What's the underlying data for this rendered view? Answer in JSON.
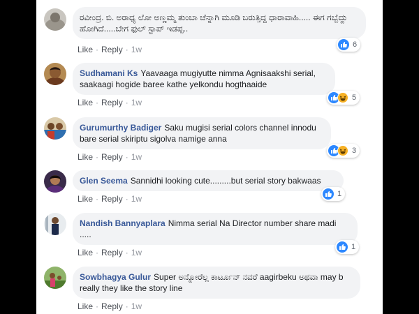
{
  "actions": {
    "like": "Like",
    "reply": "Reply",
    "separator": "·"
  },
  "comments": [
    {
      "name": "",
      "text": "ರವೀಂದ್ರ. ಬಿ. ಅರಾಧ್ಯ ಲೋ ಅಣ್ಣಮ್ಮ ತುಂಬಾ ಚೆನ್ನಾಗಿ ಮೂಡಿ ಬರುತ್ತಿದ್ದ ಧಾರಾವಾಹಿ..... ಈಗ ಗಬ್ಬೆದ್ದು ಹೋಗಿದೆ.....ಬೇಗ ಫುಲ್ ಸ್ಟಾಪ್ ಇಡಪ್ಪ..",
      "time": "1w",
      "reactions": [
        "like-icon"
      ],
      "count": "6"
    },
    {
      "name": "Sudhamani Ks",
      "text": "Yaavaaga mugiyutte nimma Agnisaakshi serial, saakaagi hogide baree kathe yelkondu hogthaaide",
      "time": "1w",
      "reactions": [
        "like-icon",
        "haha-icon"
      ],
      "count": "5"
    },
    {
      "name": "Gurumurthy Badiger",
      "text": "Saku mugisi serial colors channel innodu bare serial skiriptu sigolva namige anna",
      "time": "1w",
      "reactions": [
        "like-icon",
        "haha-icon"
      ],
      "count": "3"
    },
    {
      "name": "Glen Seema",
      "text": "Sannidhi looking cute.........but serial story bakwaas",
      "time": "1w",
      "reactions": [
        "like-icon"
      ],
      "count": "1"
    },
    {
      "name": "Nandish Bannyaplara",
      "text": "Nimma serial Na Director number share madi .....",
      "time": "1w",
      "reactions": [
        "like-icon"
      ],
      "count": "1"
    },
    {
      "name": "Sowbhagya Gulur",
      "text": "Super ಅನ್ನೋರೆಲ್ಲ ಕಾರ್ಟೂನ್ ನವರೆ aagirbeku ಅಥವಾ may b really they like the story line",
      "time": "1w",
      "reactions": [],
      "count": ""
    }
  ],
  "colors": {
    "name": "#385898",
    "bubble": "#f2f3f5",
    "like": "#2d88ff",
    "haha": "#f7b125",
    "frame": "#000000"
  }
}
